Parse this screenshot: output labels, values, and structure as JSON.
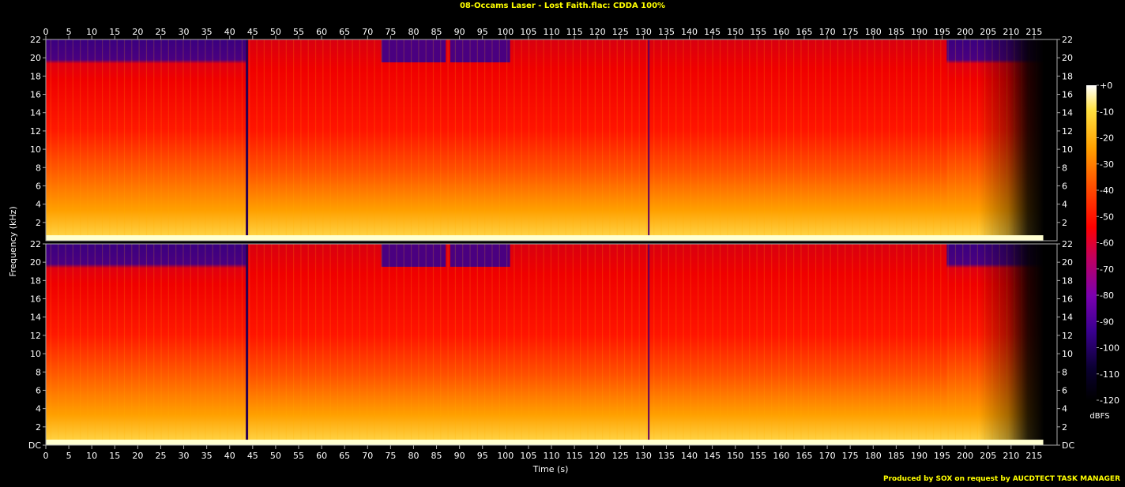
{
  "header": {
    "title": "08-Occams Laser - Lost Faith.flac: CDDA 100%",
    "footer": "Produced by SOX on request by AUCDTECT TASK MANAGER"
  },
  "colors": {
    "background": "#000000",
    "title_text": "#ffff00",
    "axis_text": "#ffffff",
    "axis_line": "#aaaaaa"
  },
  "chart_data": {
    "type": "heatmap",
    "title": "08-Occams Laser - Lost Faith.flac: CDDA 100%",
    "xlabel": "Time (s)",
    "ylabel": "Frequency (kHz)",
    "xlim": [
      0,
      220
    ],
    "ylim": [
      0,
      22
    ],
    "x_ticks": [
      0,
      5,
      10,
      15,
      20,
      25,
      30,
      35,
      40,
      45,
      50,
      55,
      60,
      65,
      70,
      75,
      80,
      85,
      90,
      95,
      100,
      105,
      110,
      115,
      120,
      125,
      130,
      135,
      140,
      145,
      150,
      155,
      160,
      165,
      170,
      175,
      180,
      185,
      190,
      195,
      200,
      205,
      210,
      215
    ],
    "y_tick_labels": [
      "DC",
      "2",
      "4",
      "6",
      "8",
      "10",
      "12",
      "14",
      "16",
      "18",
      "20",
      "22"
    ],
    "y_tick_values": [
      0,
      2,
      4,
      6,
      8,
      10,
      12,
      14,
      16,
      18,
      20,
      22
    ],
    "channels": [
      "left",
      "right"
    ],
    "colorbar": {
      "label": "dBFS",
      "range": [
        -120,
        0
      ],
      "tick_labels": [
        "+0",
        "-10",
        "-20",
        "-30",
        "-40",
        "-50",
        "-60",
        "-70",
        "-80",
        "-90",
        "-100",
        "-110",
        "-120"
      ],
      "tick_values": [
        0,
        -10,
        -20,
        -30,
        -40,
        -50,
        -60,
        -70,
        -80,
        -90,
        -100,
        -110,
        -120
      ]
    },
    "notes": {
      "dark_gap_start_s": 44,
      "high_freq_dark_band_khz": [
        19.5,
        22
      ],
      "fade_out_start_s": 203,
      "end_s": 217
    }
  }
}
